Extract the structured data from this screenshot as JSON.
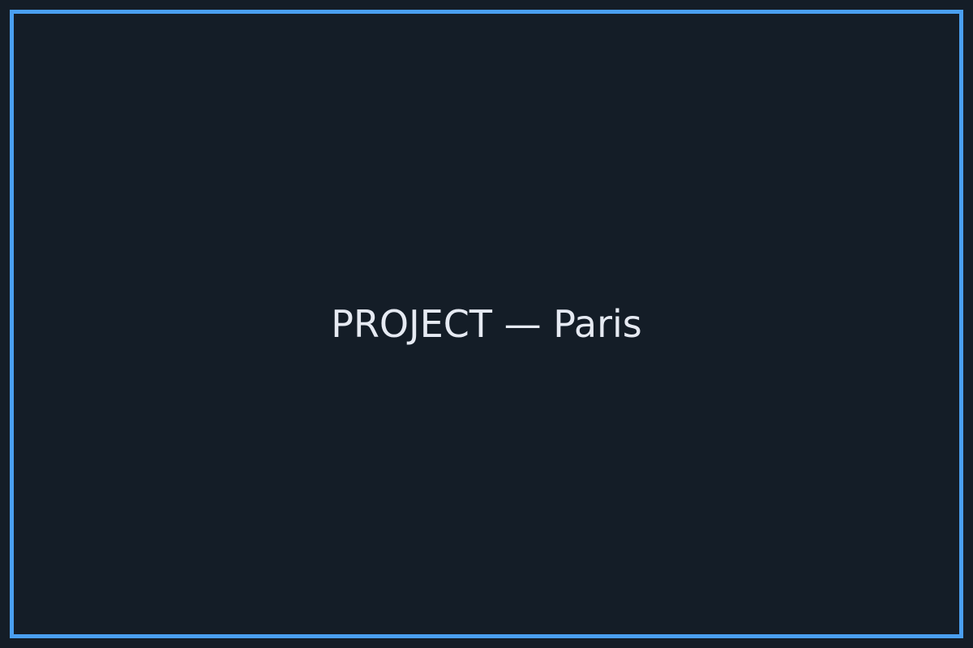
{
  "title": "PROJECT — Paris",
  "colors": {
    "background": "#141d27",
    "frame_border": "#4a9ff0",
    "text": "#e6eaf2"
  }
}
